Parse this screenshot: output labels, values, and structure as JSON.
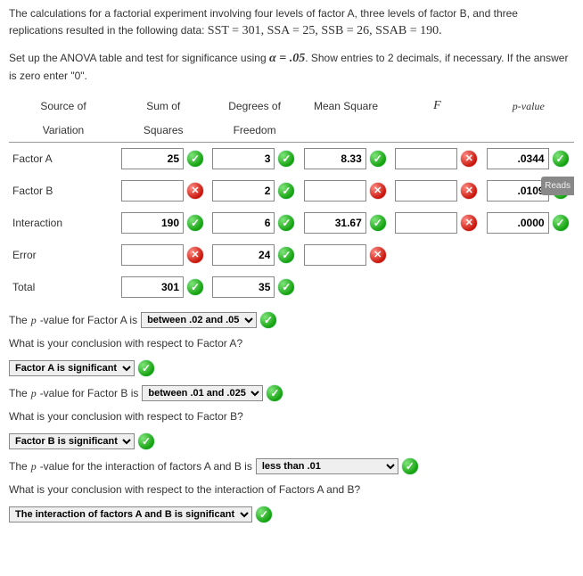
{
  "intro": {
    "line1a": "The calculations for a factorial experiment involving four levels of factor A, three levels of factor B, and three replications resulted in the following data: ",
    "eq": "SST = 301, SSA = 25, SSB = 26, SSAB = 190.",
    "line2a": "Set up the ANOVA table and test for significance using ",
    "alpha": "α = .05",
    "line2b": ". Show entries to 2 decimals, if necessary. If the answer is zero enter \"0\"."
  },
  "headers": {
    "source1": "Source of",
    "source2": "Variation",
    "ss1": "Sum of",
    "ss2": "Squares",
    "df1": "Degrees of",
    "df2": "Freedom",
    "ms": "Mean Square",
    "f": "F",
    "p": "p-value"
  },
  "rows": {
    "A": {
      "label": "Factor A",
      "ss": "25",
      "ss_ok": true,
      "df": "3",
      "df_ok": true,
      "ms": "8.33",
      "ms_ok": true,
      "f": "",
      "f_ok": false,
      "p": ".0344",
      "p_ok": true
    },
    "B": {
      "label": "Factor B",
      "ss": "",
      "ss_ok": false,
      "df": "2",
      "df_ok": true,
      "ms": "",
      "ms_ok": false,
      "f": "",
      "f_ok": false,
      "p": ".0109",
      "p_ok": true
    },
    "AB": {
      "label": "Interaction",
      "ss": "190",
      "ss_ok": true,
      "df": "6",
      "df_ok": true,
      "ms": "31.67",
      "ms_ok": true,
      "f": "",
      "f_ok": false,
      "p": ".0000",
      "p_ok": true
    },
    "Err": {
      "label": "Error",
      "ss": "",
      "ss_ok": false,
      "df": "24",
      "df_ok": true,
      "ms": "",
      "ms_ok": false
    },
    "Tot": {
      "label": "Total",
      "ss": "301",
      "ss_ok": true,
      "df": "35",
      "df_ok": true
    }
  },
  "q": {
    "pA_pre": "The ",
    "pA_mid": "p",
    "pA_post": "-value for Factor A is",
    "pA_sel": "between .02 and .05",
    "concA_q": "What is your conclusion with respect to Factor A?",
    "concA_sel": "Factor A is significant",
    "pB_post": "-value for Factor B is",
    "pB_sel": "between .01 and .025",
    "concB_q": "What is your conclusion with respect to Factor B?",
    "concB_sel": "Factor B is significant",
    "pAB_post": "-value for the interaction of factors A and B is",
    "pAB_sel": "less than .01",
    "concAB_q": "What is your conclusion with respect to the interaction of Factors A and B?",
    "concAB_sel": "The interaction of factors A and B is significant"
  },
  "badge": "Reads"
}
